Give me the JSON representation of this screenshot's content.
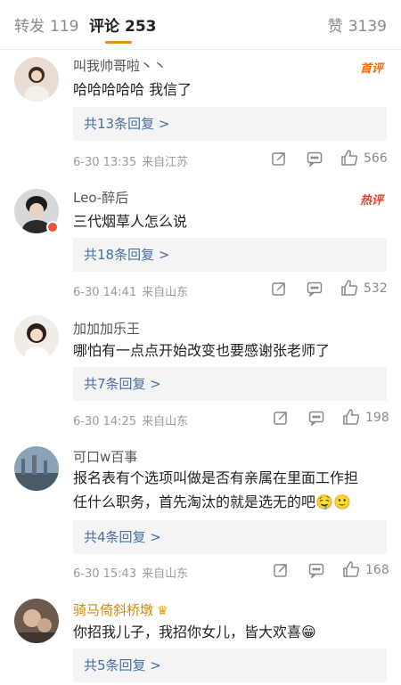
{
  "tabs": {
    "repost_label": "转发",
    "repost_count": "119",
    "comment_label": "评论",
    "comment_count": "253",
    "like_label": "赞",
    "like_count": "3139"
  },
  "comments": [
    {
      "username": "叫我帅哥啦丶丶",
      "tag": "首评",
      "text": "哈哈哈哈哈 我信了",
      "replies": "共13条回复 >",
      "time": "6-30 13:35",
      "source": "来自江苏",
      "likes": "566"
    },
    {
      "username": "Leo-醉后",
      "tag": "热评",
      "text": "三代烟草人怎么说",
      "replies": "共18条回复 >",
      "time": "6-30 14:41",
      "source": "来自山东",
      "likes": "532"
    },
    {
      "username": "加加加乐王",
      "text": "哪怕有一点点开始改变也要感谢张老师了",
      "replies": "共7条回复 >",
      "time": "6-30 14:25",
      "source": "来自山东",
      "likes": "198"
    },
    {
      "username": "可口w百事",
      "text_line1": "报名表有个选项叫做是否有亲属在里面工作担",
      "text_line2": "任什么职务，首先淘汰的就是选无的吧",
      "replies": "共4条回复 >",
      "time": "6-30 15:43",
      "source": "来自山东",
      "likes": "168"
    },
    {
      "username": "骑马倚斜桥墩",
      "text": "你招我儿子，我招你女儿，皆大欢喜",
      "replies": "共5条回复 >"
    }
  ],
  "icons": {
    "repost": "share-square-icon",
    "comment": "comment-icon",
    "like": "thumbs-up-icon"
  },
  "colors": {
    "accent": "#f08c0a",
    "link": "#4a6fa0",
    "hot_tag": "#e8402a"
  }
}
